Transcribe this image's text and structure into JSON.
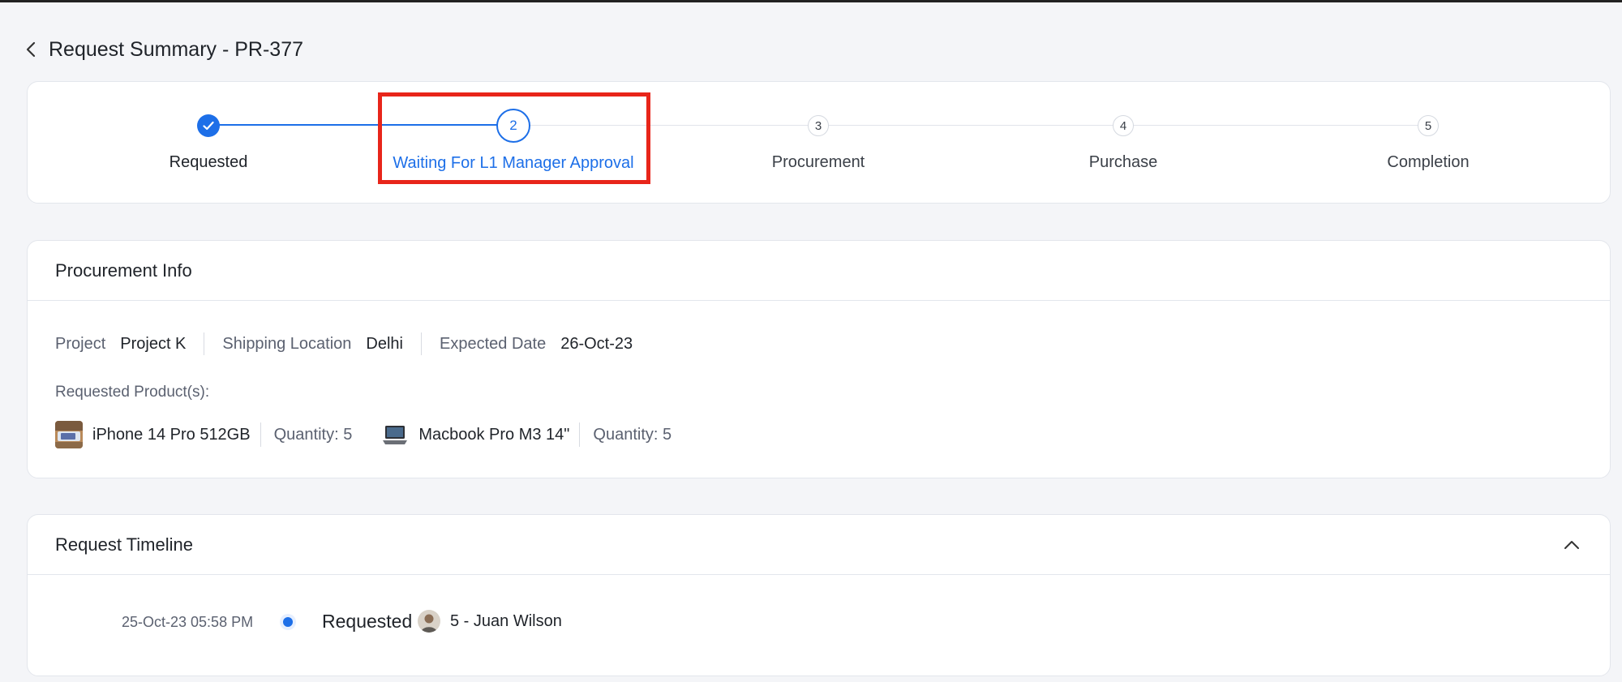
{
  "header": {
    "title": "Request Summary - PR-377"
  },
  "colors": {
    "accent": "#1d6fe8",
    "highlight": "#e8251a",
    "pending": "#3b4048"
  },
  "stepper": {
    "steps": [
      {
        "number": "",
        "label": "Requested",
        "state": "done",
        "icon": "check-icon"
      },
      {
        "number": "2",
        "label": "Waiting For L1 Manager Approval",
        "state": "active"
      },
      {
        "number": "3",
        "label": "Procurement",
        "state": "pending"
      },
      {
        "number": "4",
        "label": "Purchase",
        "state": "pending"
      },
      {
        "number": "5",
        "label": "Completion",
        "state": "pending"
      }
    ]
  },
  "procurement": {
    "title": "Procurement Info",
    "project_label": "Project",
    "project_value": "Project K",
    "location_label": "Shipping Location",
    "location_value": "Delhi",
    "date_label": "Expected Date",
    "date_value": "26-Oct-23",
    "products_label": "Requested Product(s):",
    "products": [
      {
        "name": "iPhone 14 Pro 512GB",
        "quantity": "Quantity: 5",
        "icon": "iphone-thumbnail"
      },
      {
        "name": "Macbook Pro M3 14\"",
        "quantity": "Quantity: 5",
        "icon": "macbook-thumbnail"
      }
    ]
  },
  "timeline": {
    "title": "Request Timeline",
    "entries": [
      {
        "date": "25-Oct-23 05:58 PM",
        "status": "Requested",
        "user": "5 - Juan Wilson"
      }
    ]
  }
}
